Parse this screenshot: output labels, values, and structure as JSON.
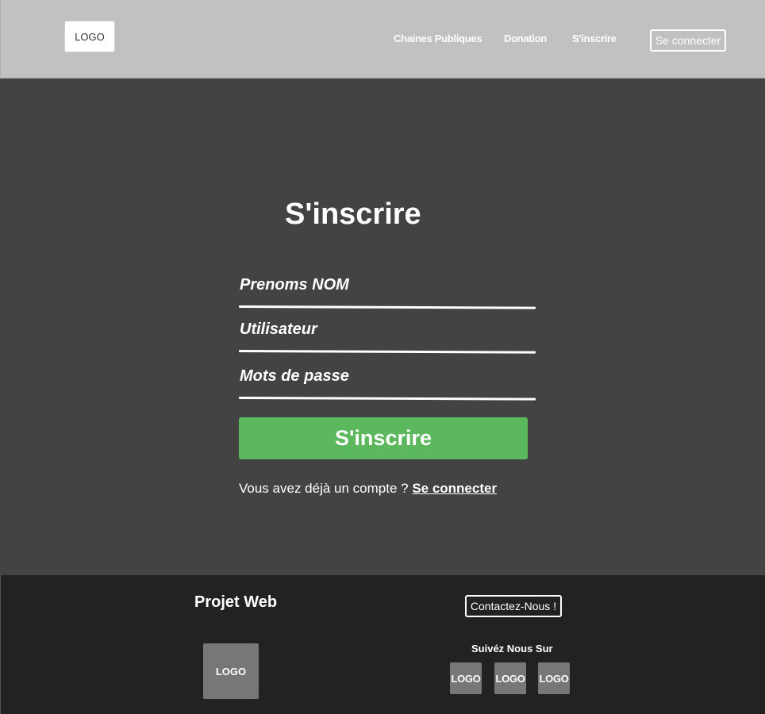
{
  "header": {
    "logo": "LOGO",
    "nav": [
      "Chaines Publiques",
      "Donation",
      "S'inscrire"
    ],
    "login_button": "Se connecter"
  },
  "main": {
    "title": "S'inscrire",
    "fields": [
      {
        "placeholder": "Prenoms NOM"
      },
      {
        "placeholder": "Utilisateur"
      },
      {
        "placeholder": "Mots de passe"
      }
    ],
    "submit_label": "S'inscrire",
    "login_prompt": "Vous avez déjà un compte ? ",
    "login_link": "Se connecter"
  },
  "footer": {
    "title": "Projet Web",
    "logo": "LOGO",
    "contact_button": "Contactez-Nous !",
    "follow_label": "Suivéz Nous Sur",
    "social_logos": [
      "LOGO",
      "LOGO",
      "LOGO"
    ]
  },
  "colors": {
    "header_bg": "#c1c1c1",
    "main_bg": "#434343",
    "footer_bg": "#222222",
    "accent_green": "#5cb85c",
    "logo_gray": "#777777"
  }
}
